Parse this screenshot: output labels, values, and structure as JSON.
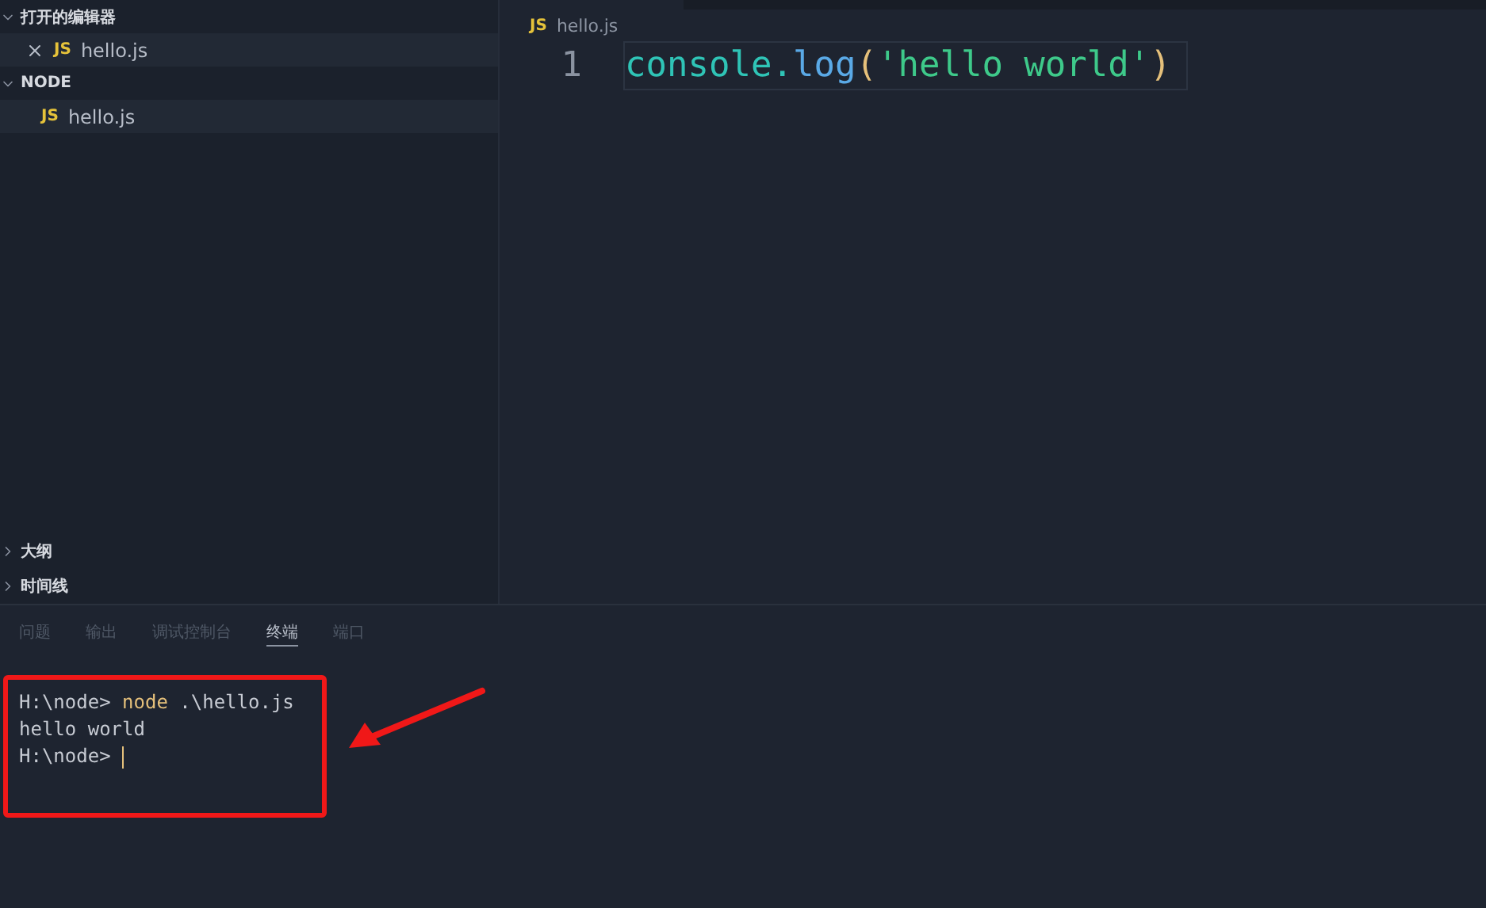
{
  "sidebar": {
    "sections": [
      {
        "title": "打开的编辑器",
        "expanded": true,
        "items": [
          {
            "label": "hello.js",
            "badge": "JS",
            "closable": true
          }
        ]
      },
      {
        "title": "NODE",
        "expanded": true,
        "items": [
          {
            "label": "hello.js",
            "badge": "JS",
            "closable": false
          }
        ]
      }
    ],
    "bottom_sections": [
      {
        "title": "大纲",
        "expanded": false
      },
      {
        "title": "时间线",
        "expanded": false
      }
    ]
  },
  "editor": {
    "tab": {
      "badge": "JS",
      "label": "hello.js"
    },
    "lines": [
      {
        "number": "1",
        "tokens": [
          {
            "text": "console.",
            "kind": "ident"
          },
          {
            "text": "log",
            "kind": "func"
          },
          {
            "text": "(",
            "kind": "paren"
          },
          {
            "text": "'hello world'",
            "kind": "string"
          },
          {
            "text": ")",
            "kind": "paren"
          }
        ]
      }
    ]
  },
  "panel": {
    "tabs": [
      {
        "label": "问题",
        "selected": false
      },
      {
        "label": "输出",
        "selected": false
      },
      {
        "label": "调试控制台",
        "selected": false
      },
      {
        "label": "终端",
        "selected": true
      },
      {
        "label": "端口",
        "selected": false
      }
    ],
    "terminal": [
      {
        "cursor": false,
        "segments": [
          {
            "text": "H:\\node> ",
            "kind": "prompt"
          },
          {
            "text": "node",
            "kind": "command"
          },
          {
            "text": " .\\hello.js",
            "kind": "arg"
          }
        ]
      },
      {
        "cursor": false,
        "segments": [
          {
            "text": "hello world",
            "kind": "output"
          }
        ]
      },
      {
        "cursor": true,
        "segments": [
          {
            "text": "H:\\node> ",
            "kind": "prompt"
          }
        ]
      }
    ]
  }
}
